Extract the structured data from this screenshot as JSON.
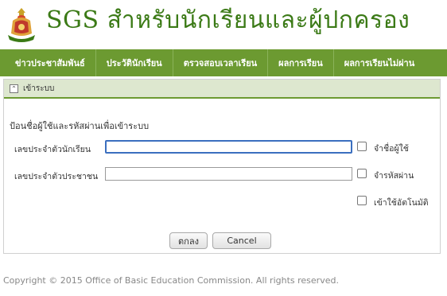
{
  "header": {
    "brand": "SGS",
    "title": "สำหรับนักเรียนและผู้ปกครอง"
  },
  "nav": [
    {
      "label": "ข่าวประชาสัมพันธ์"
    },
    {
      "label": "ประวัตินักเรียน"
    },
    {
      "label": "ตรวจสอบเวลาเรียน"
    },
    {
      "label": "ผลการเรียน"
    },
    {
      "label": "ผลการเรียนไม่ผ่าน"
    }
  ],
  "login": {
    "panel_title": "เข้าระบบ",
    "instruction": "ป้อนชื่อผู้ใช้และรหัสผ่านเพื่อเข้าระบบ",
    "student_id_label": "เลขประจำตัวนักเรียน",
    "student_id_value": "",
    "citizen_id_label": "เลขประจำตัวประชาชน",
    "citizen_id_value": "",
    "remember_user": "จำชื่อผู้ใช้",
    "remember_password": "จำรหัสผ่าน",
    "auto_login": "เข้าใช้อัตโนมัติ",
    "ok_button": "ตกลง",
    "cancel_button": "Cancel"
  },
  "footer": {
    "copyright": "Copyright © 2015 Office of Basic Education Commission. All rights reserved."
  },
  "colors": {
    "brand_green": "#3b7a16",
    "nav_green": "#6c9a31",
    "focus_blue": "#3b6fbf"
  },
  "icons": {
    "logo": "obec-emblem",
    "collapse": "collapse-up-icon"
  }
}
